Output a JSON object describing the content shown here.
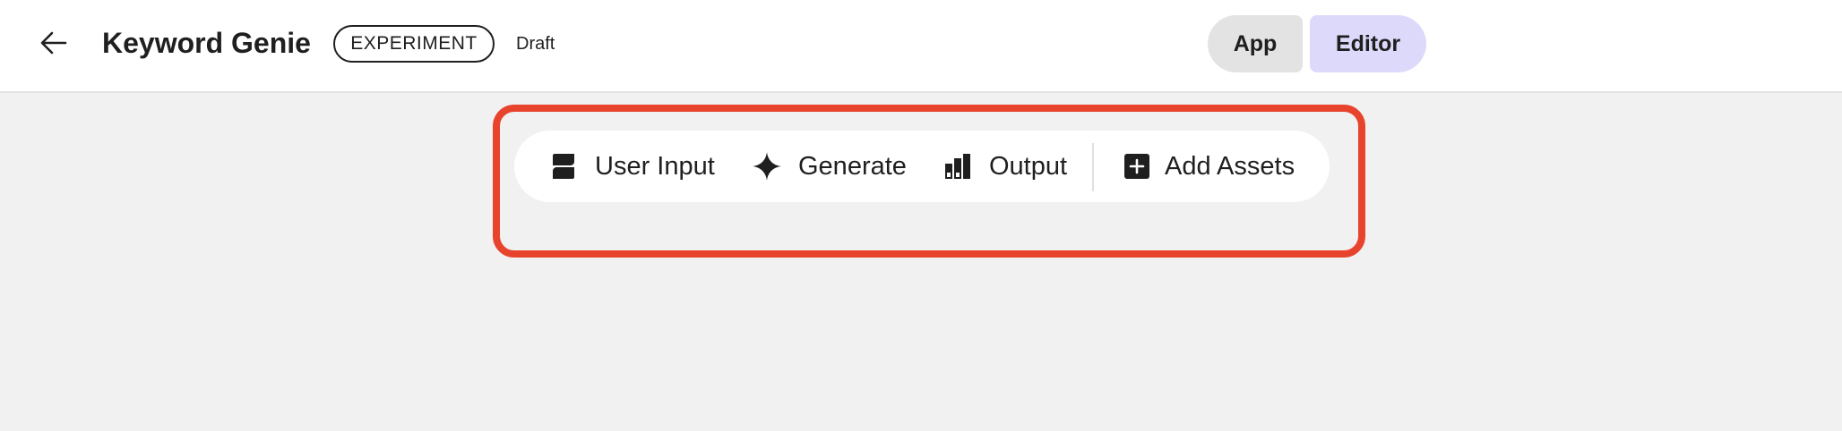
{
  "header": {
    "back_icon": "arrow-left-icon",
    "title": "Keyword Genie",
    "badge": "EXPERIMENT",
    "status": "Draft",
    "modes": [
      {
        "label": "App",
        "selected": false
      },
      {
        "label": "Editor",
        "selected": true
      }
    ]
  },
  "toolbar": {
    "items": [
      {
        "label": "User Input",
        "icon": "user-input-icon"
      },
      {
        "label": "Generate",
        "icon": "sparkle-icon"
      },
      {
        "label": "Output",
        "icon": "output-icon"
      },
      {
        "label": "Add Assets",
        "icon": "add-box-icon"
      }
    ]
  },
  "colors": {
    "highlight": "#e8442d",
    "editor_selected": "#dcd9fb",
    "app_bg": "#e3e3e3",
    "canvas": "#f1f1f1"
  }
}
